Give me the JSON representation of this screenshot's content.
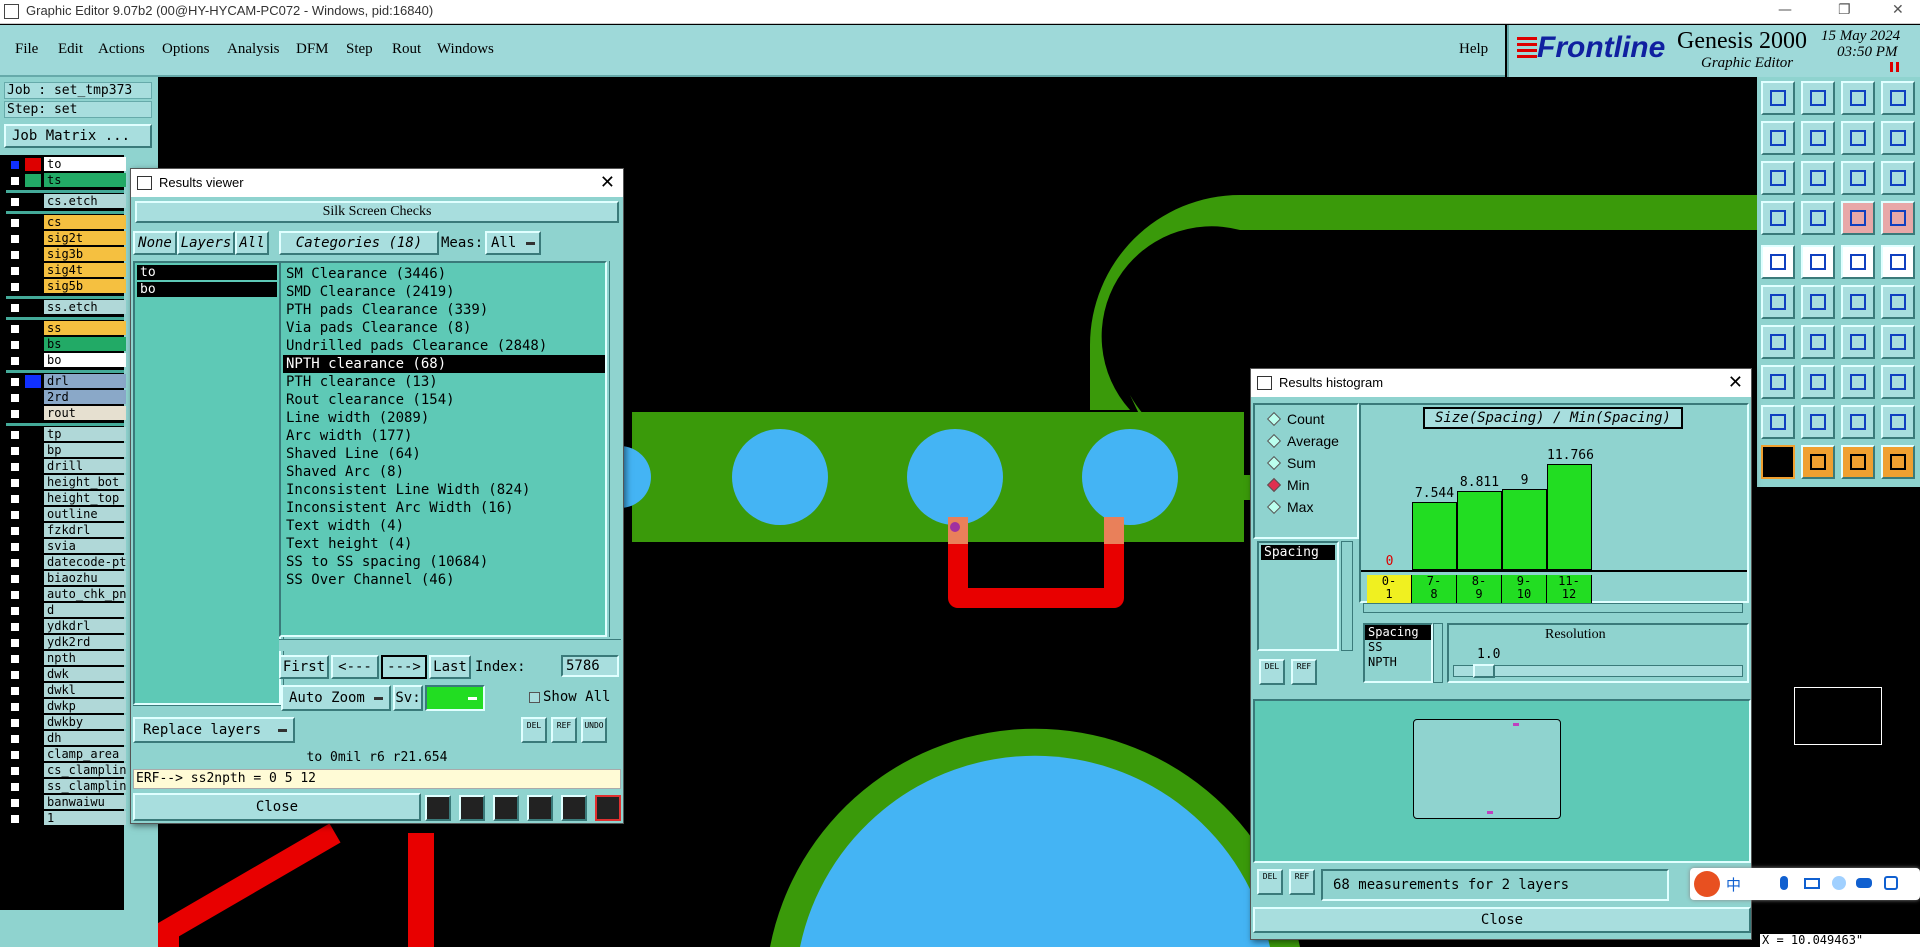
{
  "window": {
    "title": "Graphic Editor 9.07b2 (00@HY-HYCAM-PC072 - Windows, pid:16840)"
  },
  "menu": [
    "File",
    "Edit",
    "Actions",
    "Options",
    "Analysis",
    "DFM",
    "Step",
    "Rout",
    "Windows"
  ],
  "help_label": "Help",
  "brand": {
    "logo": "Frontline",
    "product": "Genesis 2000",
    "subtitle": "Graphic Editor",
    "date": "15 May 2024",
    "time": "03:50 PM"
  },
  "job": {
    "job_label": "Job : set_tmp373",
    "step_label": "Step: set",
    "matrix_button": "Job Matrix ..."
  },
  "layers": [
    {
      "name": "to",
      "swatch": "#d00",
      "bg": "#fff",
      "group": 1,
      "first": true
    },
    {
      "name": "ts",
      "swatch": "#22aa66",
      "bg": "#22aa66",
      "group": 1
    },
    {
      "name": "cs.etch",
      "swatch": "#000",
      "bg": "#b0d8d8",
      "group": 2
    },
    {
      "name": "cs",
      "swatch": "#000",
      "bg": "#f5c040",
      "group": 3
    },
    {
      "name": "sig2t",
      "swatch": "#000",
      "bg": "#f5c040",
      "group": 3
    },
    {
      "name": "sig3b",
      "swatch": "#000",
      "bg": "#f5c040",
      "group": 3
    },
    {
      "name": "sig4t",
      "swatch": "#000",
      "bg": "#f5c040",
      "group": 3
    },
    {
      "name": "sig5b",
      "swatch": "#000",
      "bg": "#f5c040",
      "group": 3
    },
    {
      "name": "ss.etch",
      "swatch": "#000",
      "bg": "#b0d8d8",
      "group": 4
    },
    {
      "name": "ss",
      "swatch": "#000",
      "bg": "#f5c040",
      "group": 5
    },
    {
      "name": "bs",
      "swatch": "#000",
      "bg": "#22aa66",
      "group": 5
    },
    {
      "name": "bo",
      "swatch": "#000",
      "bg": "#fff",
      "group": 5
    },
    {
      "name": "drl",
      "swatch": "#1030ff",
      "bg": "#8aa8c8",
      "group": 6
    },
    {
      "name": "2rd",
      "swatch": "#000",
      "bg": "#8aa8c8",
      "group": 6
    },
    {
      "name": "rout",
      "swatch": "#000",
      "bg": "#e6e0d0",
      "group": 6
    },
    {
      "name": "tp",
      "swatch": "#000",
      "bg": "#b0d8d8",
      "group": 7
    },
    {
      "name": "bp",
      "swatch": "#000",
      "bg": "#b0d8d8",
      "group": 7
    },
    {
      "name": "drill",
      "swatch": "#000",
      "bg": "#b0d8d8",
      "group": 7
    },
    {
      "name": "height_bot",
      "swatch": "#000",
      "bg": "#b0d8d8",
      "group": 7
    },
    {
      "name": "height_top",
      "swatch": "#000",
      "bg": "#b0d8d8",
      "group": 7
    },
    {
      "name": "outline",
      "swatch": "#000",
      "bg": "#b0d8d8",
      "group": 7
    },
    {
      "name": "fzkdrl",
      "swatch": "#000",
      "bg": "#b0d8d8",
      "group": 7
    },
    {
      "name": "svia",
      "swatch": "#000",
      "bg": "#b0d8d8",
      "group": 7
    },
    {
      "name": "datecode-pt",
      "swatch": "#000",
      "bg": "#b0d8d8",
      "group": 7
    },
    {
      "name": "biaozhu",
      "swatch": "#000",
      "bg": "#b0d8d8",
      "group": 7
    },
    {
      "name": "auto_chk_pn",
      "swatch": "#000",
      "bg": "#b0d8d8",
      "group": 7
    },
    {
      "name": "d",
      "swatch": "#000",
      "bg": "#b0d8d8",
      "group": 7
    },
    {
      "name": "ydkdrl",
      "swatch": "#000",
      "bg": "#b0d8d8",
      "group": 7
    },
    {
      "name": "ydk2rd",
      "swatch": "#000",
      "bg": "#b0d8d8",
      "group": 7
    },
    {
      "name": "npth",
      "swatch": "#000",
      "bg": "#b0d8d8",
      "group": 7
    },
    {
      "name": "dwk",
      "swatch": "#000",
      "bg": "#b0d8d8",
      "group": 7
    },
    {
      "name": "dwkl",
      "swatch": "#000",
      "bg": "#b0d8d8",
      "group": 7
    },
    {
      "name": "dwkp",
      "swatch": "#000",
      "bg": "#b0d8d8",
      "group": 7
    },
    {
      "name": "dwkby",
      "swatch": "#000",
      "bg": "#b0d8d8",
      "group": 7
    },
    {
      "name": "dh",
      "swatch": "#000",
      "bg": "#b0d8d8",
      "group": 7
    },
    {
      "name": "clamp_area",
      "swatch": "#000",
      "bg": "#b0d8d8",
      "group": 7
    },
    {
      "name": "cs_clampline",
      "swatch": "#000",
      "bg": "#b0d8d8",
      "group": 7
    },
    {
      "name": "ss_clampline",
      "swatch": "#000",
      "bg": "#b0d8d8",
      "group": 7
    },
    {
      "name": "banwaiwu",
      "swatch": "#000",
      "bg": "#b0d8d8",
      "group": 7
    },
    {
      "name": "1",
      "swatch": "#000",
      "bg": "#b0d8d8",
      "group": 7
    }
  ],
  "results_viewer": {
    "title": "Results viewer",
    "header": "Silk Screen Checks",
    "none_btn": "None",
    "layers_btn": "Layers",
    "all_btn": "All",
    "categories_btn": "Categories (18)",
    "meas_label": "Meas:",
    "meas_value": "All",
    "layer_list": [
      "to",
      "bo"
    ],
    "categories": [
      "SM Clearance (3446)",
      "SMD Clearance (2419)",
      "PTH pads Clearance (339)",
      "Via pads Clearance (8)",
      "Undrilled pads Clearance (2848)",
      "NPTH clearance (68)",
      "PTH clearance (13)",
      "Rout clearance (154)",
      "Line width (2089)",
      "Arc width (177)",
      "Shaved Line (64)",
      "Shaved Arc (8)",
      "Inconsistent Line Width (824)",
      "Inconsistent Arc Width (16)",
      "Text width (4)",
      "Text height (4)",
      "SS to SS spacing (10684)",
      "SS Over Channel (46)"
    ],
    "selected_category": 5,
    "nav": {
      "first": "First",
      "prev": "<---",
      "next": "--->",
      "last": "Last",
      "index_label": "Index:",
      "index_value": "5786"
    },
    "zoom": "Auto Zoom",
    "sv_label": "Sv:",
    "show_all": "Show All",
    "replace": "Replace layers",
    "icons": {
      "del": "DEL",
      "ref": "REF",
      "undo": "UNDO"
    },
    "status": "to 0mil  r6  r21.654",
    "erf": "ERF--> ss2npth = 0 5 12",
    "close": "Close"
  },
  "histogram": {
    "title": "Results histogram",
    "modes": [
      "Count",
      "Average",
      "Sum",
      "Min",
      "Max"
    ],
    "selected_mode": 3,
    "chart_title": "Size(Spacing) / Min(Spacing)",
    "bins": [
      {
        "label1": "0-",
        "label2": "1",
        "value": 0,
        "value_label": "0"
      },
      {
        "label1": "7-",
        "label2": "8",
        "value": 7.544,
        "value_label": "7.544"
      },
      {
        "label1": "8-",
        "label2": "9",
        "value": 8.811,
        "value_label": "8.811"
      },
      {
        "label1": "9-",
        "label2": "10",
        "value": 9,
        "value_label": "9"
      },
      {
        "label1": "11-",
        "label2": "12",
        "value": 11.766,
        "value_label": "11.766"
      }
    ],
    "attr_list": [
      "Spacing"
    ],
    "attr_list2": [
      "Spacing",
      "SS",
      "NPTH"
    ],
    "resolution_label": "Resolution",
    "resolution_value": "1.0",
    "icons": {
      "del": "DEL",
      "ref": "REF"
    },
    "summary": "68 measurements for 2 layers",
    "close": "Close"
  },
  "coord_readout": "X = 10.049463\"",
  "ime_char": "中"
}
